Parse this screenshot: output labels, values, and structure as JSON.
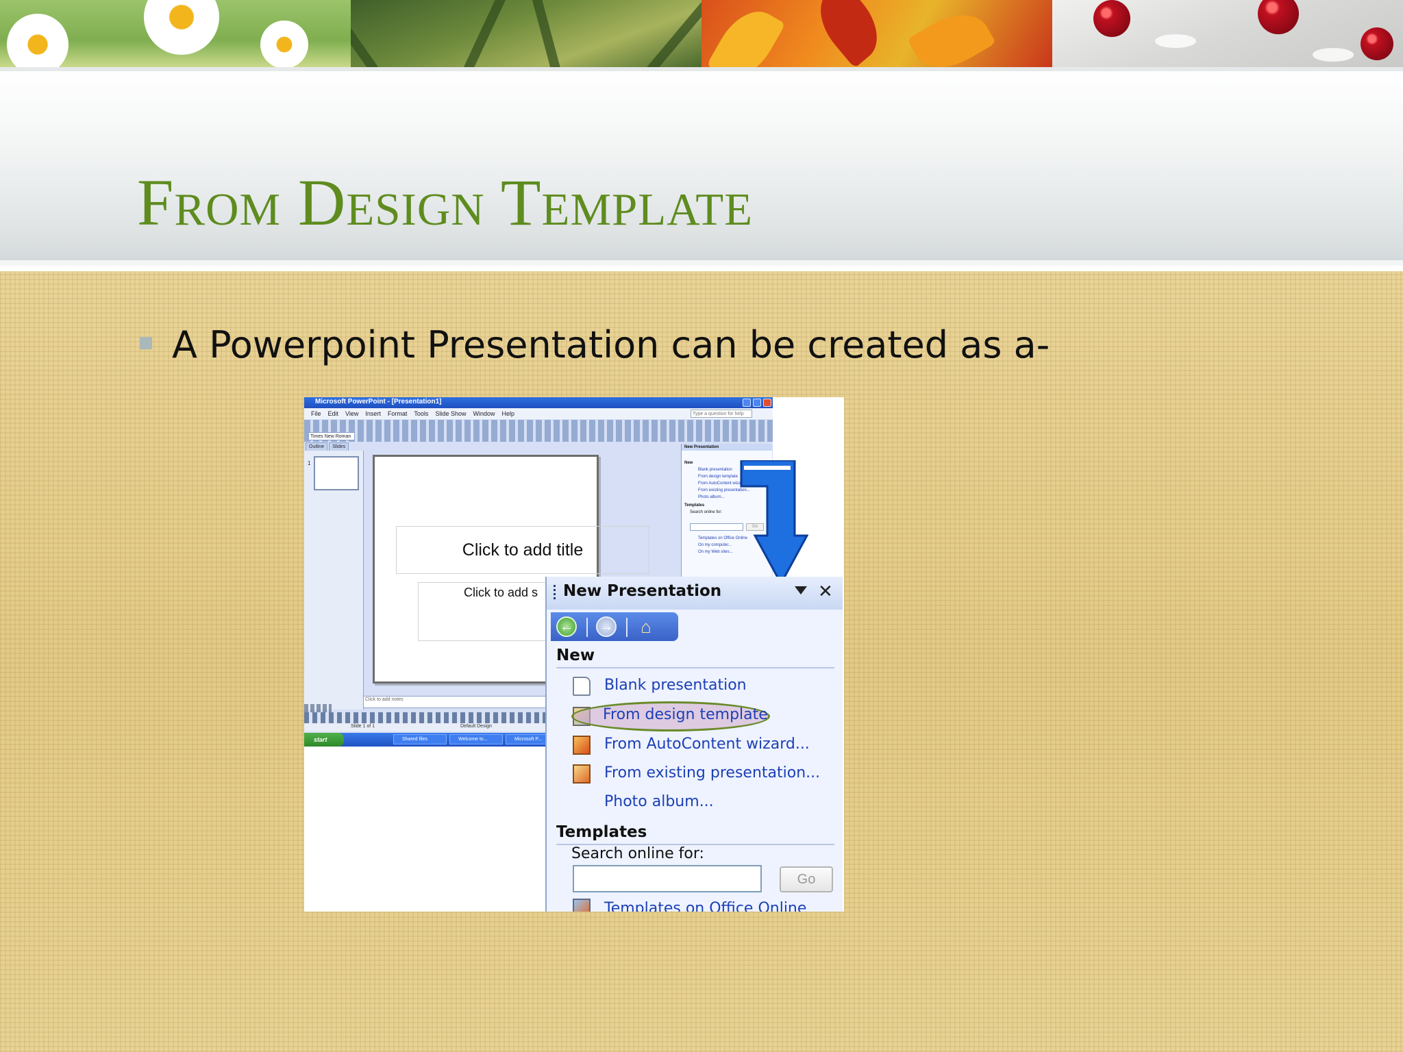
{
  "slide": {
    "title": "From Design Template",
    "bullet": "A Powerpoint Presentation can be created as a-"
  },
  "banner": {
    "seasons": [
      "spring-daisies",
      "summer-palms",
      "autumn-leaves",
      "winter-berries"
    ]
  },
  "mini_window": {
    "title": "Microsoft PowerPoint - [Presentation1]",
    "menu": [
      "File",
      "Edit",
      "View",
      "Insert",
      "Format",
      "Tools",
      "Slide Show",
      "Window",
      "Help"
    ],
    "help_placeholder": "Type a question for help",
    "font_name": "Times New Roman",
    "tabs": [
      "Outline",
      "Slides"
    ],
    "thumb_number": "1",
    "title_placeholder": "Click to add title",
    "subtitle_placeholder": "Click to add s",
    "notes_placeholder": "Click to add notes",
    "status_slide": "Slide 1 of 1",
    "status_design": "Default Design",
    "start_label": "start",
    "taskbar_items": [
      "Shared files",
      "Welcome to...",
      "Microsoft P..."
    ],
    "task_pane": {
      "title": "New Presentation",
      "new_heading": "New",
      "items": [
        "Blank presentation",
        "From design template",
        "From AutoContent wizard...",
        "From existing presentation...",
        "Photo album..."
      ],
      "templates_heading": "Templates",
      "search_label": "Search online for:",
      "go_label": "Go",
      "template_links": [
        "Templates on Office Online",
        "On my computer...",
        "On my Web sites..."
      ]
    }
  },
  "zoom_pane": {
    "title": "New Presentation",
    "new_heading": "New",
    "blank": "Blank presentation",
    "design": "From design template",
    "autocontent": "From AutoContent wizard...",
    "existing": "From existing presentation...",
    "photo": "Photo album...",
    "templates_heading": "Templates",
    "search_label": "Search online for:",
    "go_label": "Go",
    "online": "Templates on Office Online"
  },
  "colors": {
    "title_green": "#5e8c1f",
    "link_blue": "#1c3fb6",
    "arrow_blue": "#1e6fe0",
    "highlight_ring": "#6a8a2a"
  }
}
